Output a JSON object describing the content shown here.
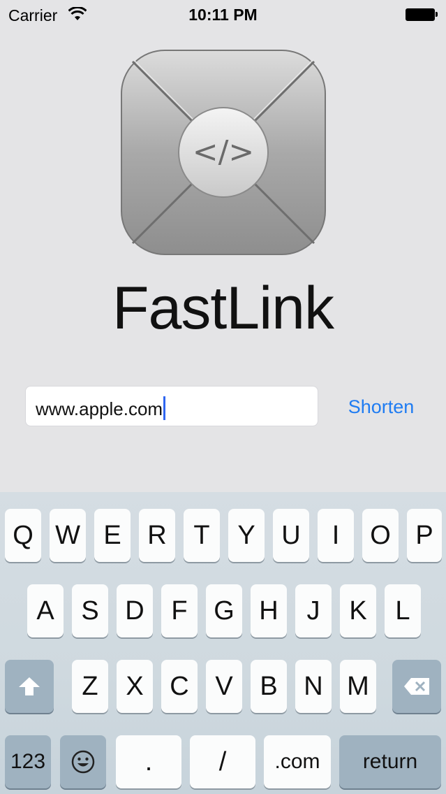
{
  "status_bar": {
    "carrier": "Carrier",
    "time": "10:11 PM"
  },
  "app": {
    "title": "FastLink",
    "icon": "fastlink-code-icon",
    "icon_glyph": "</>"
  },
  "url_field": {
    "value": "www.apple.com"
  },
  "shorten_label": "Shorten",
  "colors": {
    "accent": "#1f7cf2",
    "background": "#e4e4e6",
    "caret": "#2f66f0"
  },
  "keyboard": {
    "row1": [
      "Q",
      "W",
      "E",
      "R",
      "T",
      "Y",
      "U",
      "I",
      "O",
      "P"
    ],
    "row2": [
      "A",
      "S",
      "D",
      "F",
      "G",
      "H",
      "J",
      "K",
      "L"
    ],
    "row3": [
      "Z",
      "X",
      "C",
      "V",
      "B",
      "N",
      "M"
    ],
    "bottom": {
      "numbers": "123",
      "dot": ".",
      "slash": "/",
      "dotcom": ".com",
      "return": "return"
    }
  }
}
